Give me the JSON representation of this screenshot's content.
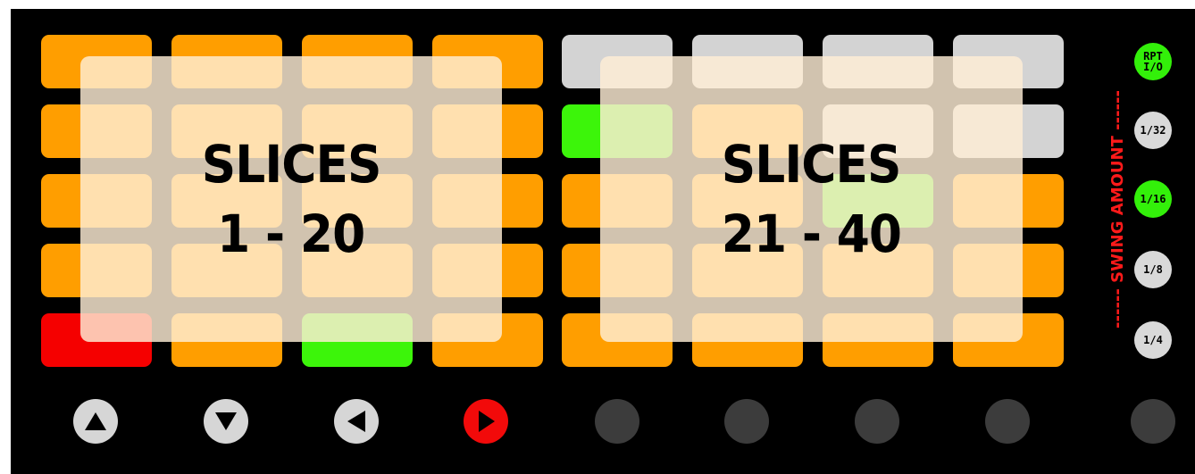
{
  "colors": {
    "orange": "#ff9e00",
    "gray": "#d3d3d3",
    "green": "#3cf50a",
    "red": "#f50000",
    "overlay": "rgba(255,238,214,0.82)",
    "swing_label": "#ff1a1a"
  },
  "left_grid": {
    "overlay_line1": "SLICES",
    "overlay_line2": "1 - 20",
    "rows": [
      [
        "orange",
        "orange",
        "orange",
        "orange"
      ],
      [
        "orange",
        "orange",
        "orange",
        "orange"
      ],
      [
        "orange",
        "orange",
        "orange",
        "orange"
      ],
      [
        "orange",
        "orange",
        "orange",
        "orange"
      ],
      [
        "red",
        "orange",
        "green",
        "orange"
      ]
    ]
  },
  "right_grid": {
    "overlay_line1": "SLICES",
    "overlay_line2": "21 - 40",
    "rows": [
      [
        "gray",
        "gray",
        "gray",
        "gray"
      ],
      [
        "green",
        "orange",
        "gray",
        "gray"
      ],
      [
        "orange",
        "orange",
        "green",
        "orange"
      ],
      [
        "orange",
        "orange",
        "orange",
        "orange"
      ],
      [
        "orange",
        "orange",
        "orange",
        "orange"
      ]
    ]
  },
  "bottom_controls": [
    {
      "name": "arrow-up-button",
      "icon": "triangle-up-icon",
      "color": "white"
    },
    {
      "name": "arrow-down-button",
      "icon": "triangle-down-icon",
      "color": "white"
    },
    {
      "name": "arrow-left-button",
      "icon": "triangle-left-icon",
      "color": "white"
    },
    {
      "name": "arrow-right-button",
      "icon": "triangle-right-icon",
      "color": "red"
    },
    {
      "name": "scene-button-5",
      "color": "dark"
    },
    {
      "name": "scene-button-6",
      "color": "dark"
    },
    {
      "name": "scene-button-7",
      "color": "dark"
    },
    {
      "name": "scene-button-8",
      "color": "dark"
    },
    {
      "name": "scene-button-9",
      "color": "dark"
    }
  ],
  "side_buttons": {
    "rpt_line1": "RPT",
    "rpt_line2": "I/O",
    "b1": "1/32",
    "b2": "1/16",
    "b3": "1/8",
    "b4": "1/4"
  },
  "swing_label": "------ SWING AMOUNT ------"
}
